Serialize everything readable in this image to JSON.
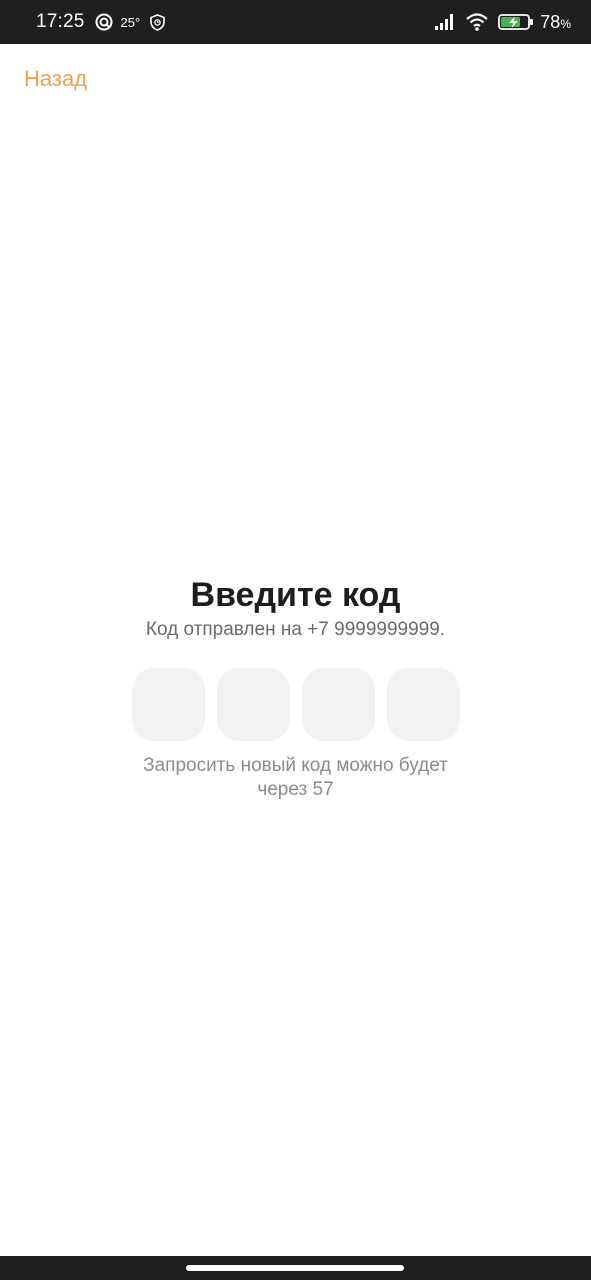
{
  "status_bar": {
    "time": "17:25",
    "temperature": "25°",
    "battery_number": "78",
    "battery_unit": "%",
    "icons": [
      "quick-settings-icon",
      "shield-icon",
      "signal-icon",
      "wifi-icon",
      "battery-charging-icon"
    ]
  },
  "header": {
    "back_label": "Назад"
  },
  "main": {
    "title": "Введите код",
    "subtitle": "Код отправлен на +7 9999999999.",
    "code_cells": [
      "",
      "",
      "",
      ""
    ],
    "resend_text": "Запросить новый код можно будет через 57"
  },
  "colors": {
    "accent": "#f0a24a",
    "title": "#1d1d1d",
    "subtitle": "#6b6b6b",
    "muted": "#8c8c8c",
    "cell_background": "#f2f2f2",
    "status_bar": "#1f1f1f",
    "battery_fill": "#4caf50"
  }
}
